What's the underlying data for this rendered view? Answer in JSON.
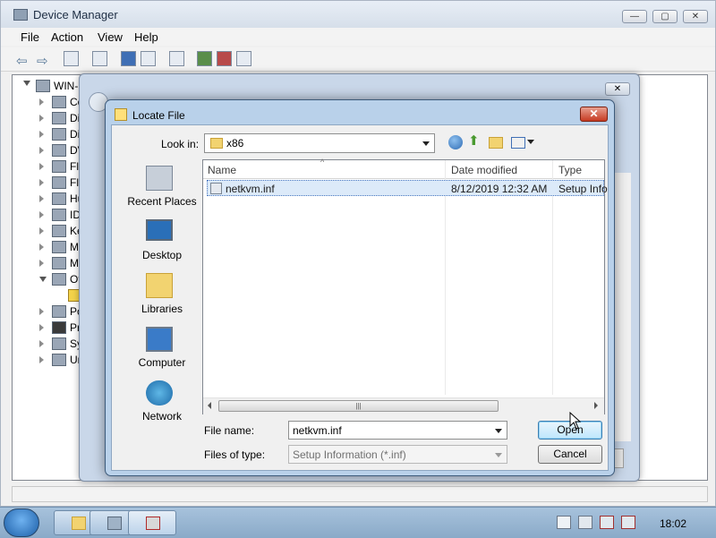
{
  "device_manager": {
    "title": "Device Manager",
    "menu": [
      "File",
      "Action",
      "View",
      "Help"
    ],
    "tree_root": "WIN-I",
    "tree_items": [
      "Co",
      "Di",
      "Di",
      "DV",
      "Flo",
      "Flo",
      "Hu",
      "ID",
      "Ke",
      "Mi",
      "Mi",
      "Ot",
      "",
      "Po",
      "Pr",
      "Sy",
      "Ur"
    ]
  },
  "dialog": {
    "title": "Locate File",
    "look_in_label": "Look in:",
    "look_in_value": "x86",
    "places": [
      "Recent Places",
      "Desktop",
      "Libraries",
      "Computer",
      "Network"
    ],
    "columns": [
      "Name",
      "Date modified",
      "Type"
    ],
    "files": [
      {
        "name": "netkvm.inf",
        "date": "8/12/2019 12:32 AM",
        "type": "Setup Info"
      }
    ],
    "file_name_label": "File name:",
    "file_name_value": "netkvm.inf",
    "files_of_type_label": "Files of type:",
    "files_of_type_value": "Setup Information (*.inf)",
    "open_label": "Open",
    "cancel_label": "Cancel"
  },
  "taskbar": {
    "clock": "18:02"
  }
}
